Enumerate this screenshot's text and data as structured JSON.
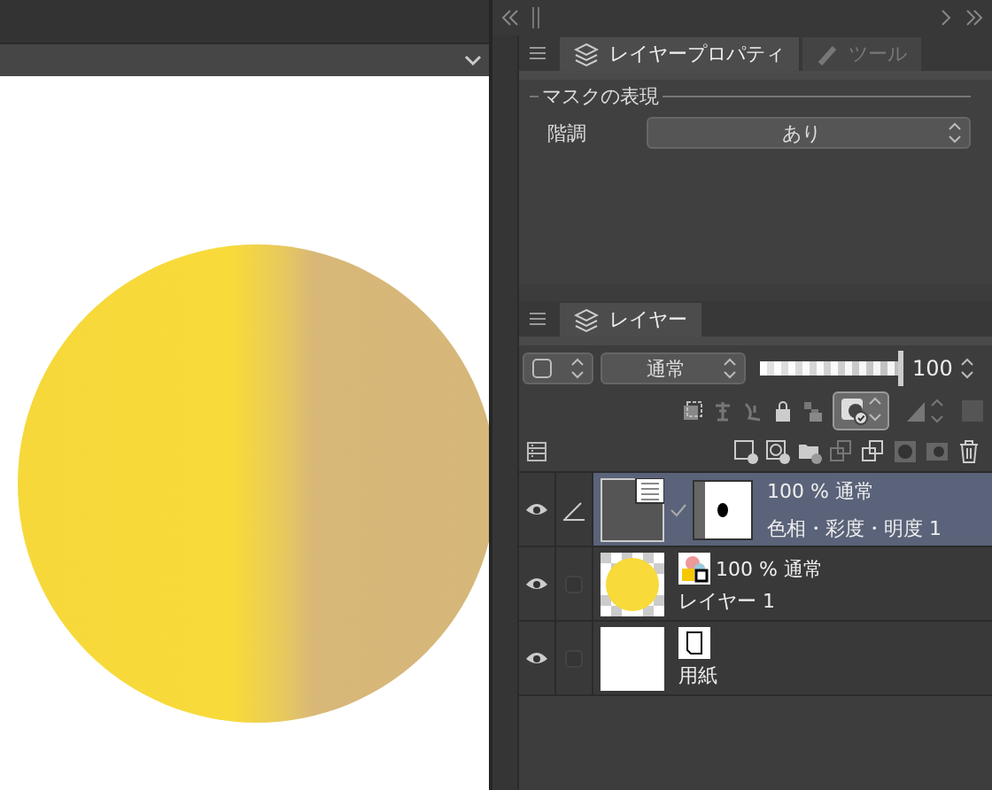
{
  "property_panel": {
    "tabs": [
      {
        "label": "レイヤープロパティ",
        "selected": true
      },
      {
        "label": "ツール",
        "selected": false
      }
    ],
    "group": "マスクの表現",
    "fields": [
      {
        "label": "階調",
        "value": "あり"
      }
    ]
  },
  "layer_panel": {
    "tabs": [
      {
        "label": "レイヤー",
        "selected": true
      }
    ],
    "blend_mode": "通常",
    "mask_display": {
      "selected": true
    },
    "opacity": {
      "level": 1,
      "reading": "100"
    },
    "layers": [
      {
        "kind": "correction",
        "opacity_mode": "100 % 通常",
        "name": "色相・彩度・明度 1",
        "selected": true,
        "visible": true,
        "editing": true
      },
      {
        "kind": "raster",
        "opacity_mode": "100 % 通常",
        "name": "レイヤー 1",
        "selected": false,
        "visible": true,
        "editing": false
      },
      {
        "kind": "paper",
        "name": "用紙",
        "selected": false,
        "visible": true,
        "editing": false
      }
    ]
  }
}
